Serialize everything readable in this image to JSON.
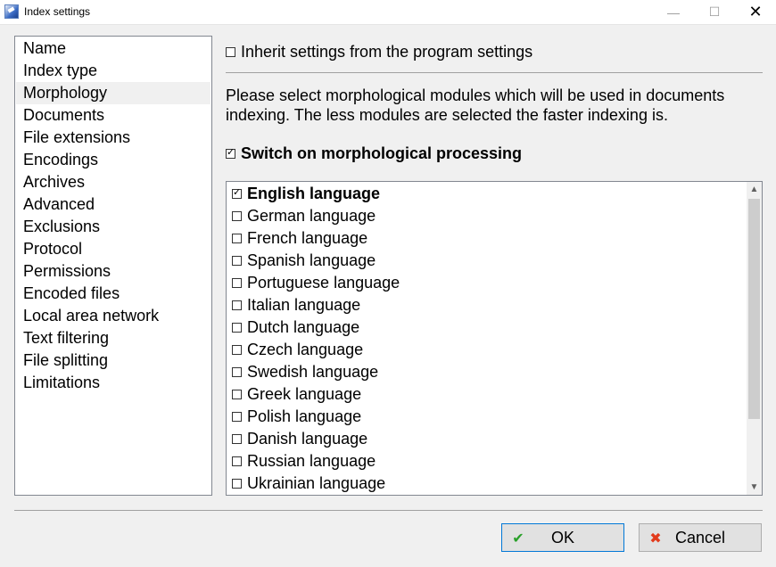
{
  "window": {
    "title": "Index settings",
    "min_icon": "minimize-icon",
    "max_icon": "maximize-icon",
    "close_icon": "close-icon"
  },
  "nav": {
    "selected": "Morphology",
    "items": [
      "Name",
      "Index type",
      "Morphology",
      "Documents",
      "File extensions",
      "Encodings",
      "Archives",
      "Advanced",
      "Exclusions",
      "Protocol",
      "Permissions",
      "Encoded files",
      "Local area network",
      "Text filtering",
      "File splitting",
      "Limitations"
    ]
  },
  "settings": {
    "inherit_label": "Inherit settings from the program settings",
    "inherit_checked": false,
    "description": "Please select morphological modules which will be used in documents indexing. The less modules are selected the faster indexing is.",
    "switch_label": "Switch on morphological processing",
    "switch_checked": true
  },
  "languages": [
    {
      "label": "English language",
      "checked": true
    },
    {
      "label": "German language",
      "checked": false
    },
    {
      "label": "French language",
      "checked": false
    },
    {
      "label": "Spanish language",
      "checked": false
    },
    {
      "label": "Portuguese language",
      "checked": false
    },
    {
      "label": "Italian language",
      "checked": false
    },
    {
      "label": "Dutch language",
      "checked": false
    },
    {
      "label": "Czech language",
      "checked": false
    },
    {
      "label": "Swedish language",
      "checked": false
    },
    {
      "label": "Greek language",
      "checked": false
    },
    {
      "label": "Polish language",
      "checked": false
    },
    {
      "label": "Danish language",
      "checked": false
    },
    {
      "label": "Russian language",
      "checked": false
    },
    {
      "label": "Ukrainian language",
      "checked": false
    }
  ],
  "buttons": {
    "ok_label": "OK",
    "ok_icon": "check-icon",
    "cancel_label": "Cancel",
    "cancel_icon": "cross-icon"
  }
}
